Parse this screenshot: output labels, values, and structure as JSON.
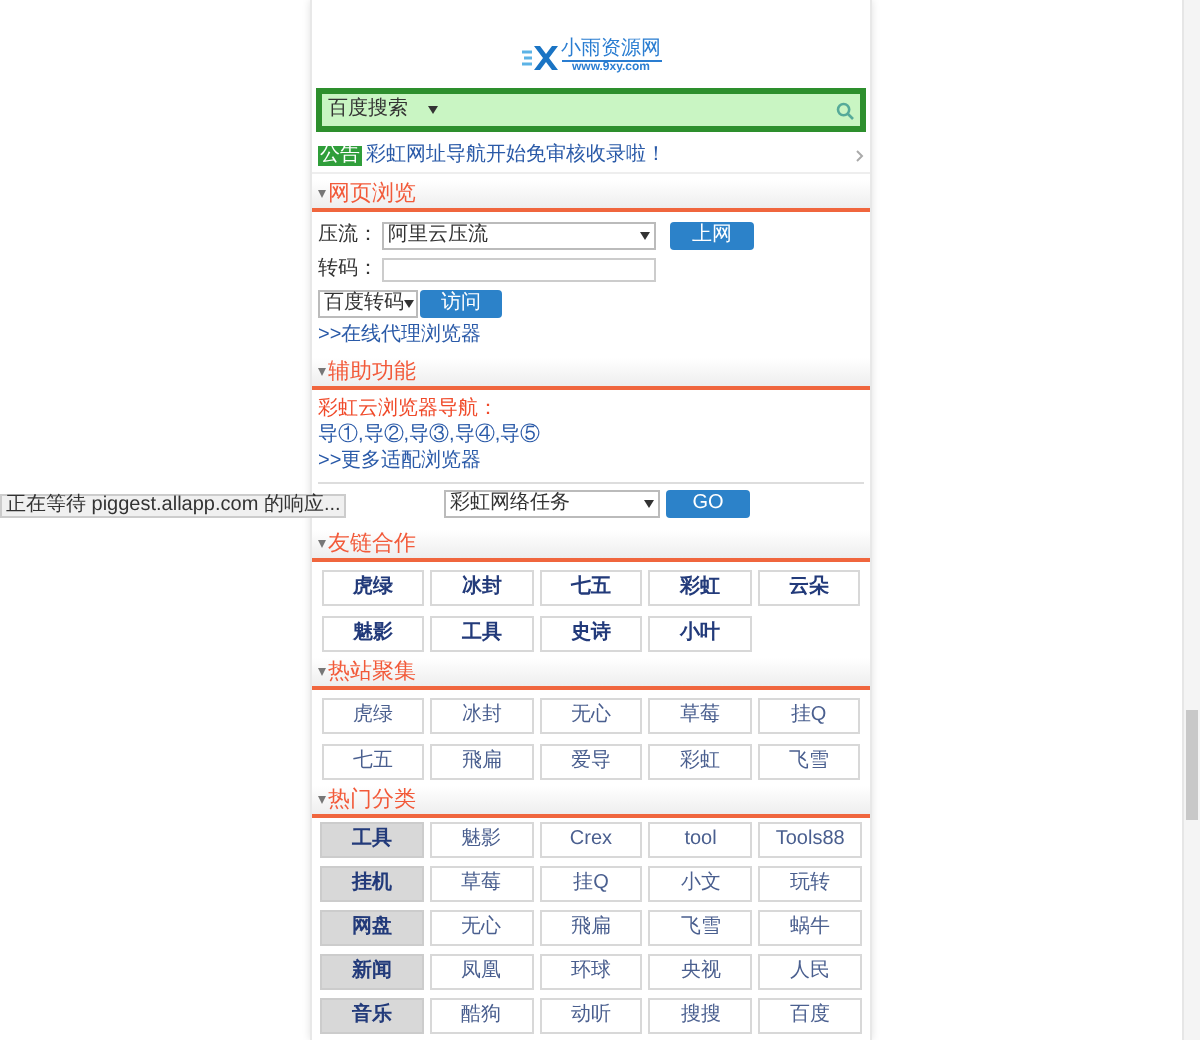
{
  "logo": {
    "name": "小雨资源网",
    "url": "www.9xy.com"
  },
  "search": {
    "engine": "百度搜索"
  },
  "notice": {
    "badge": "公告",
    "text": "彩虹网址导航开始免审核收录啦！"
  },
  "browse": {
    "title": "网页浏览",
    "proxy_label": "压流：",
    "proxy_select": "阿里云压流",
    "proxy_button": "上网",
    "transcode_label": "转码：",
    "transcode_select": "百度转码",
    "transcode_button": "访问",
    "link": ">>在线代理浏览器"
  },
  "assist": {
    "title": "辅助功能",
    "heading": "彩虹云浏览器导航：",
    "links": "导①,导②,导③,导④,导⑤",
    "link": ">>更多适配浏览器",
    "task_select": "彩虹网络任务",
    "task_button": "GO"
  },
  "friend_links": {
    "title": "友链合作",
    "items": [
      "虎绿",
      "冰封",
      "七五",
      "彩虹",
      "云朵",
      "魅影",
      "工具",
      "史诗",
      "小叶"
    ]
  },
  "hot_sites": {
    "title": "热站聚集",
    "items": [
      "虎绿",
      "冰封",
      "无心",
      "草莓",
      "挂Q",
      "七五",
      "飛扁",
      "爱导",
      "彩虹",
      "飞雪"
    ]
  },
  "categories": {
    "title": "热门分类",
    "rows": [
      {
        "label": "工具",
        "items": [
          "魅影",
          "Crex",
          "tool",
          "Tools88"
        ]
      },
      {
        "label": "挂机",
        "items": [
          "草莓",
          "挂Q",
          "小文",
          "玩转"
        ]
      },
      {
        "label": "网盘",
        "items": [
          "无心",
          "飛扁",
          "飞雪",
          "蜗牛"
        ]
      },
      {
        "label": "新闻",
        "items": [
          "凤凰",
          "环球",
          "央视",
          "人民"
        ]
      },
      {
        "label": "音乐",
        "items": [
          "酷狗",
          "动听",
          "搜搜",
          "百度"
        ]
      }
    ]
  },
  "status_bar": "正在等待 piggest.allapp.com 的响应..."
}
